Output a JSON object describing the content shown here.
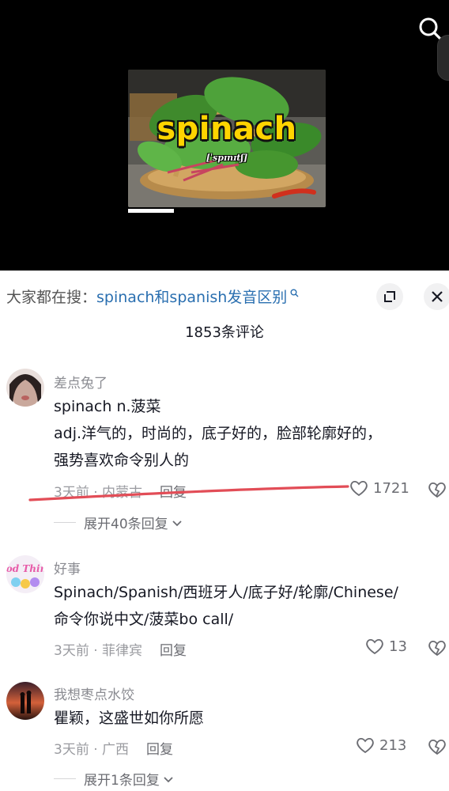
{
  "video": {
    "thumbnail_word": "spinach",
    "thumbnail_ipa": "[ˈspɪnɪtʃ]"
  },
  "trending": {
    "prefix": "大家都在搜：",
    "query": "spinach和spanish发音区别"
  },
  "comments_count": "1853条评论",
  "comments": [
    {
      "username": "差点兔了",
      "lines": [
        "spinach  n.菠菜",
        "adj.洋气的，时尚的，底子好的，脸部轮廓好的，",
        "强势喜欢命令别人的"
      ],
      "meta": "3天前 · 内蒙古",
      "reply_label": "回复",
      "likes": "1721",
      "expand_label": "展开40条回复"
    },
    {
      "username": "好事",
      "lines": [
        "Spinach/Spanish/西班牙人/底子好/轮廓/Chinese/",
        "命令你说中文/菠菜bo call/"
      ],
      "meta": "3天前 · 菲律宾",
      "reply_label": "回复",
      "likes": "13"
    },
    {
      "username": "我想枣点水饺",
      "lines": [
        "瞿颖，这盛世如你所愿"
      ],
      "meta": "3天前 · 广西",
      "reply_label": "回复",
      "likes": "213",
      "expand_label": "展开1条回复"
    }
  ],
  "avatar_badge_text": "Good Things",
  "icons": {
    "search": "search-icon",
    "expand": "expand-icon",
    "close": "close-icon",
    "like": "heart-icon",
    "dislike": "broken-heart-icon",
    "chevron": "chevron-down-icon"
  },
  "colors": {
    "link_blue": "#2a6fb0",
    "annotation_red": "#e24d57",
    "caption_yellow": "#ffd400"
  }
}
